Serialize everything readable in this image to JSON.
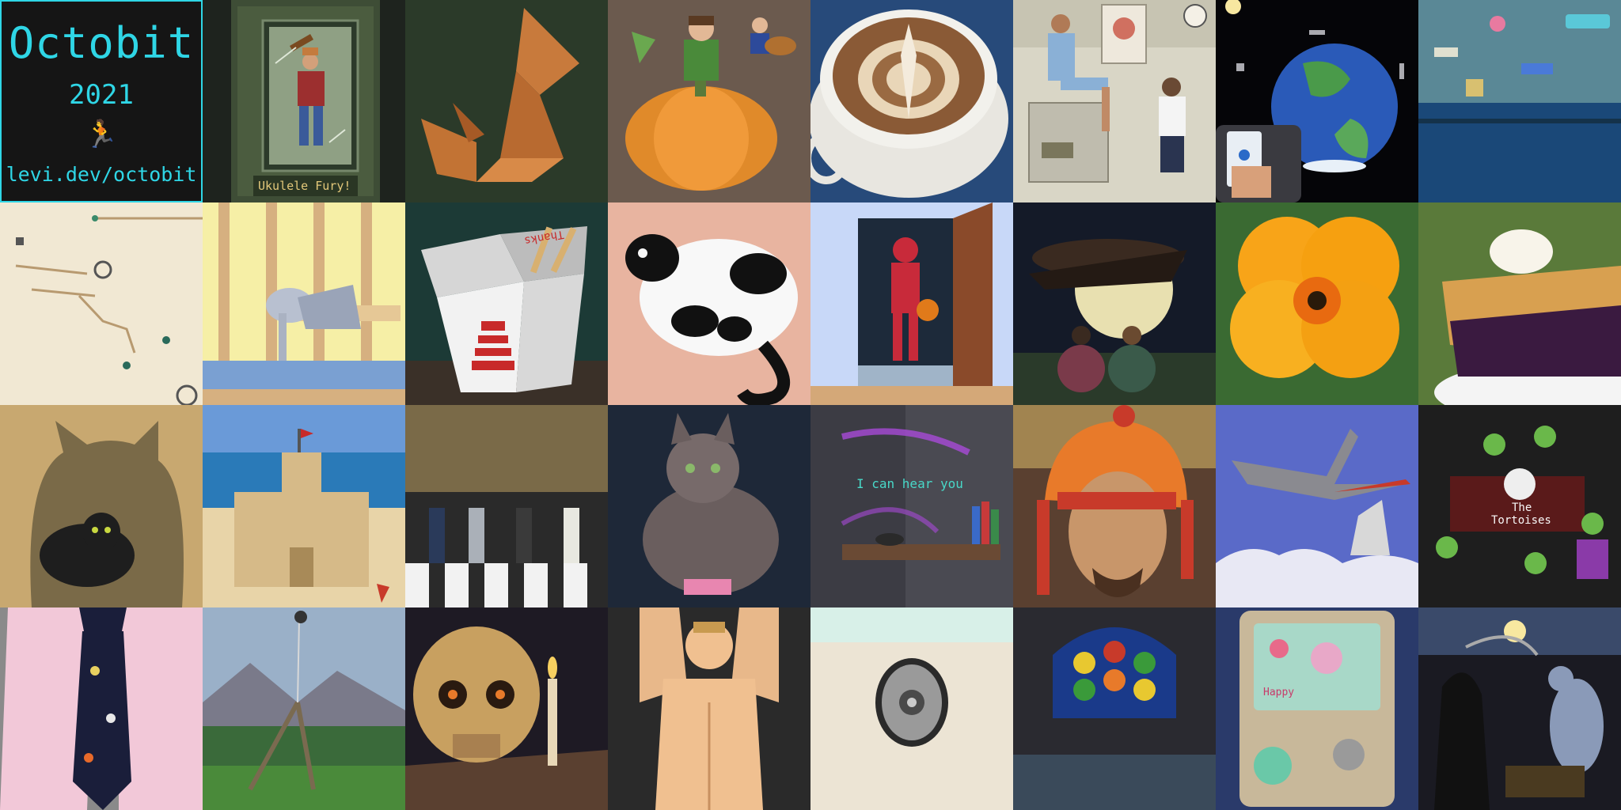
{
  "title_tile": {
    "name": "Octobit",
    "year": "2021",
    "runner_glyph": "🏃",
    "url": "levi.dev/octobit"
  },
  "tiles": {
    "ukulele_fury": {
      "caption": "Ukulele Fury!"
    },
    "takeout_box": {
      "caption": "Thanks"
    },
    "voice_assistant": {
      "caption": "I can hear you"
    },
    "band": {
      "caption_line1": "The",
      "caption_line2": "Tortoises"
    },
    "game_device": {
      "caption": "Happy"
    }
  },
  "accent_color": "#2fd6e6"
}
